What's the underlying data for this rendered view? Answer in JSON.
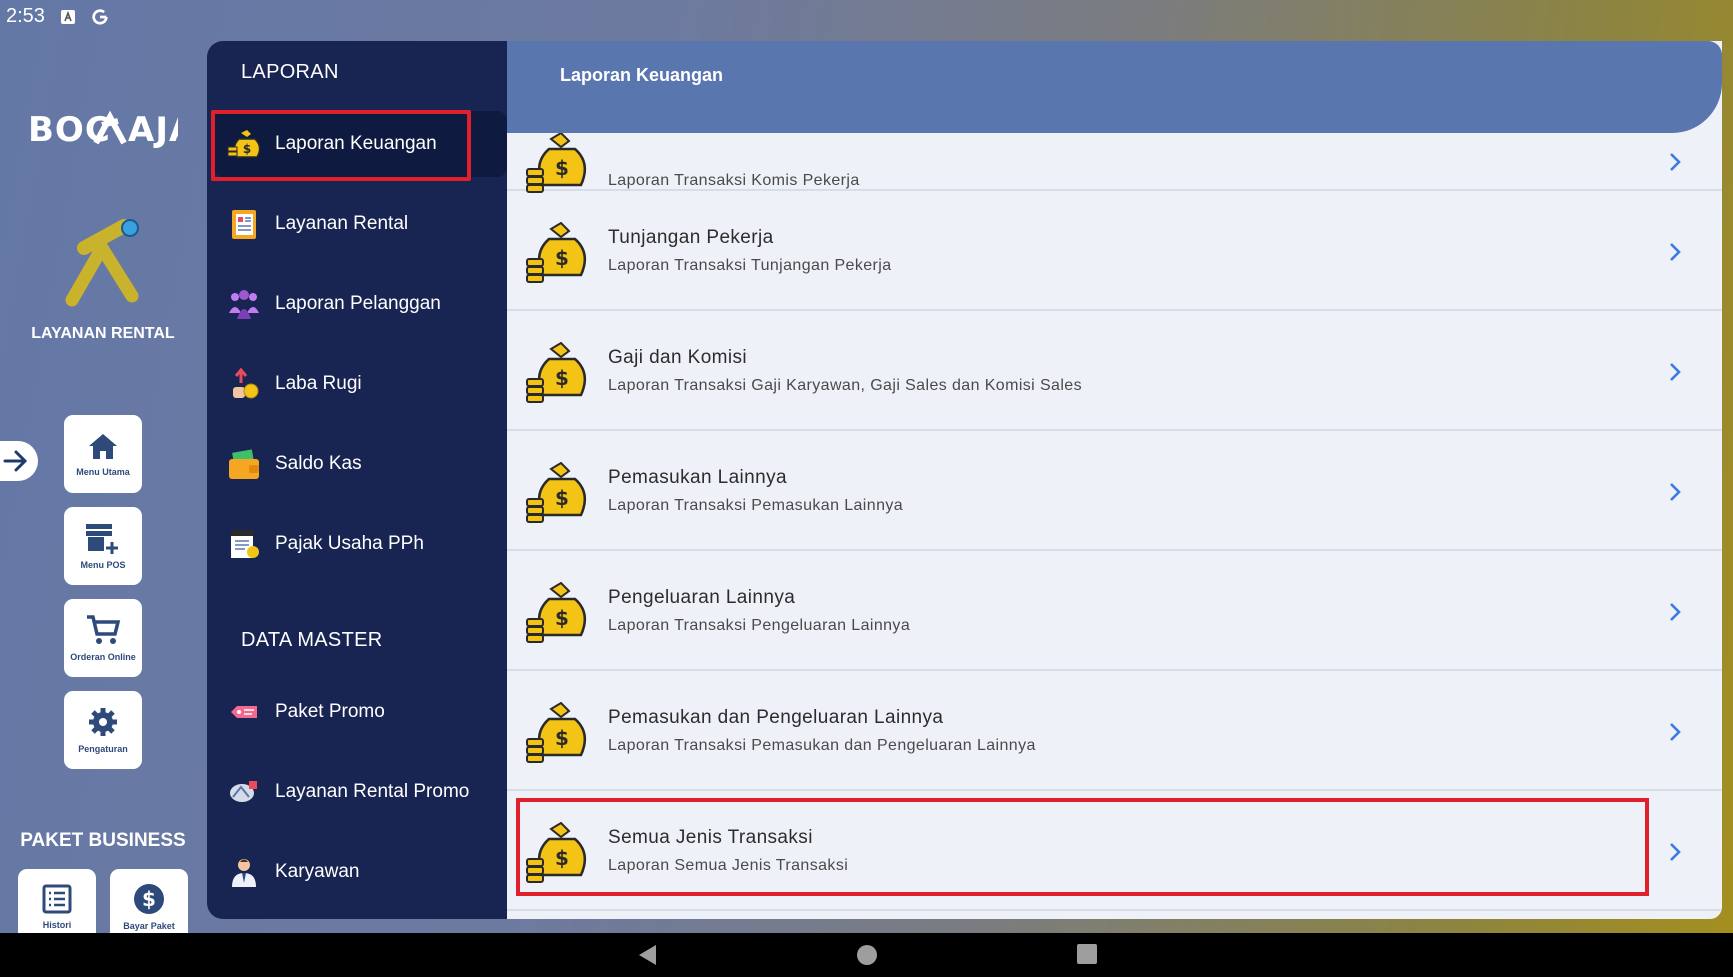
{
  "status_bar": {
    "time": "2:53"
  },
  "rail": {
    "logo_text": "BOC AJA",
    "app_name": "LAYANAN RENTAL",
    "buttons": [
      {
        "label": "Menu Utama",
        "icon": "home-icon"
      },
      {
        "label": "Menu POS",
        "icon": "store-add-icon"
      },
      {
        "label": "Orderan Online",
        "icon": "cart-icon"
      },
      {
        "label": "Pengaturan",
        "icon": "gear-icon"
      }
    ],
    "paket_title": "PAKET BUSINESS",
    "small_buttons": [
      {
        "label": "Histori",
        "icon": "list-icon"
      },
      {
        "label": "Bayar Paket",
        "icon": "dollar-icon"
      }
    ]
  },
  "menu": {
    "section_laporan": "LAPORAN",
    "laporan_items": [
      {
        "label": "Laporan Keuangan",
        "icon": "money-bag-icon"
      },
      {
        "label": "Layanan Rental",
        "icon": "report-icon"
      },
      {
        "label": "Laporan Pelanggan",
        "icon": "customers-icon"
      },
      {
        "label": "Laba Rugi",
        "icon": "profit-icon"
      },
      {
        "label": "Saldo Kas",
        "icon": "wallet-icon"
      },
      {
        "label": "Pajak Usaha PPh",
        "icon": "tax-icon"
      }
    ],
    "section_master": "DATA MASTER",
    "master_items": [
      {
        "label": "Paket Promo",
        "icon": "promo-tag-icon"
      },
      {
        "label": "Layanan Rental Promo",
        "icon": "promo-service-icon"
      },
      {
        "label": "Karyawan",
        "icon": "employee-icon"
      }
    ]
  },
  "content": {
    "title": "Laporan Keuangan",
    "rows": [
      {
        "title": "",
        "subtitle": "Laporan Transaksi Komis Pekerja"
      },
      {
        "title": "Tunjangan Pekerja",
        "subtitle": "Laporan Transaksi Tunjangan Pekerja"
      },
      {
        "title": "Gaji dan Komisi",
        "subtitle": "Laporan Transaksi Gaji Karyawan, Gaji Sales dan Komisi Sales"
      },
      {
        "title": "Pemasukan Lainnya",
        "subtitle": "Laporan Transaksi Pemasukan Lainnya"
      },
      {
        "title": "Pengeluaran Lainnya",
        "subtitle": "Laporan Transaksi Pengeluaran Lainnya"
      },
      {
        "title": "Pemasukan dan Pengeluaran Lainnya",
        "subtitle": "Laporan Transaksi Pemasukan dan Pengeluaran Lainnya"
      },
      {
        "title": "Semua Jenis Transaksi",
        "subtitle": "Laporan Semua Jenis Transaksi"
      }
    ]
  },
  "colors": {
    "menu_bg": "#182451",
    "header_bg": "#5a76ae",
    "content_bg": "#eef2f8",
    "highlight": "#e0202a",
    "chevron": "#3a7be0"
  }
}
